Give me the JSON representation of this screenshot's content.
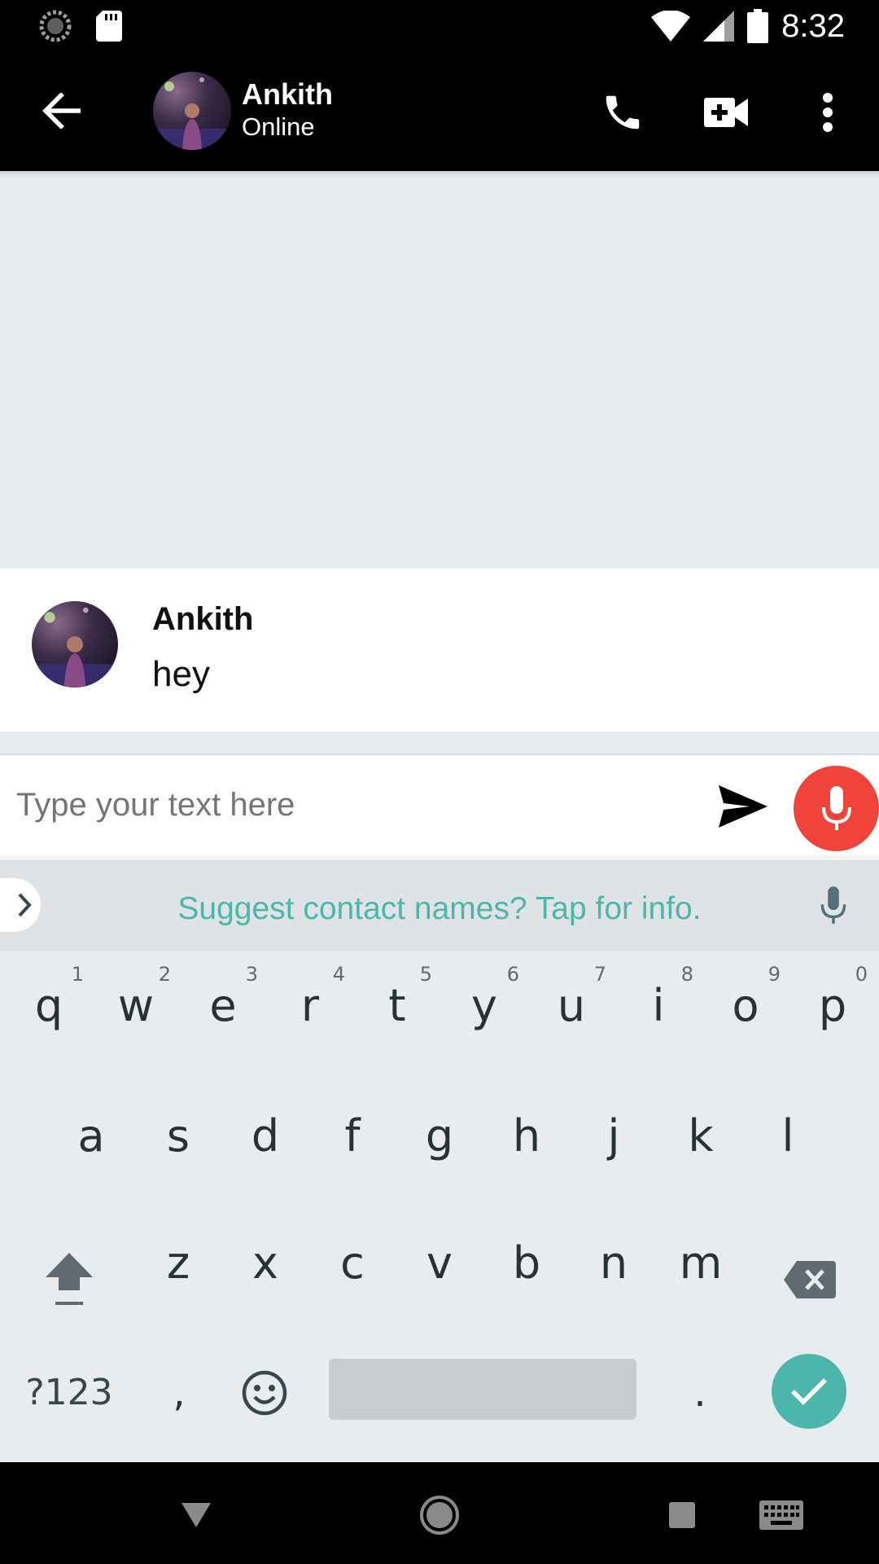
{
  "status_bar": {
    "time": "8:32"
  },
  "app_bar": {
    "contact_name": "Ankith",
    "contact_status": "Online"
  },
  "message": {
    "sender": "Ankith",
    "text": "hey"
  },
  "composer": {
    "placeholder": "Type your text here"
  },
  "keyboard": {
    "suggestion": "Suggest contact names? Tap for info.",
    "row1": [
      {
        "key": "q",
        "hint": "1"
      },
      {
        "key": "w",
        "hint": "2"
      },
      {
        "key": "e",
        "hint": "3"
      },
      {
        "key": "r",
        "hint": "4"
      },
      {
        "key": "t",
        "hint": "5"
      },
      {
        "key": "y",
        "hint": "6"
      },
      {
        "key": "u",
        "hint": "7"
      },
      {
        "key": "i",
        "hint": "8"
      },
      {
        "key": "o",
        "hint": "9"
      },
      {
        "key": "p",
        "hint": "0"
      }
    ],
    "row2": [
      "a",
      "s",
      "d",
      "f",
      "g",
      "h",
      "j",
      "k",
      "l"
    ],
    "row3": [
      "z",
      "x",
      "c",
      "v",
      "b",
      "n",
      "m"
    ],
    "symbols_label": "?123",
    "comma_label": ",",
    "period_label": "."
  },
  "colors": {
    "accent_teal": "#4db6ac",
    "mic_red": "#f0433a"
  }
}
